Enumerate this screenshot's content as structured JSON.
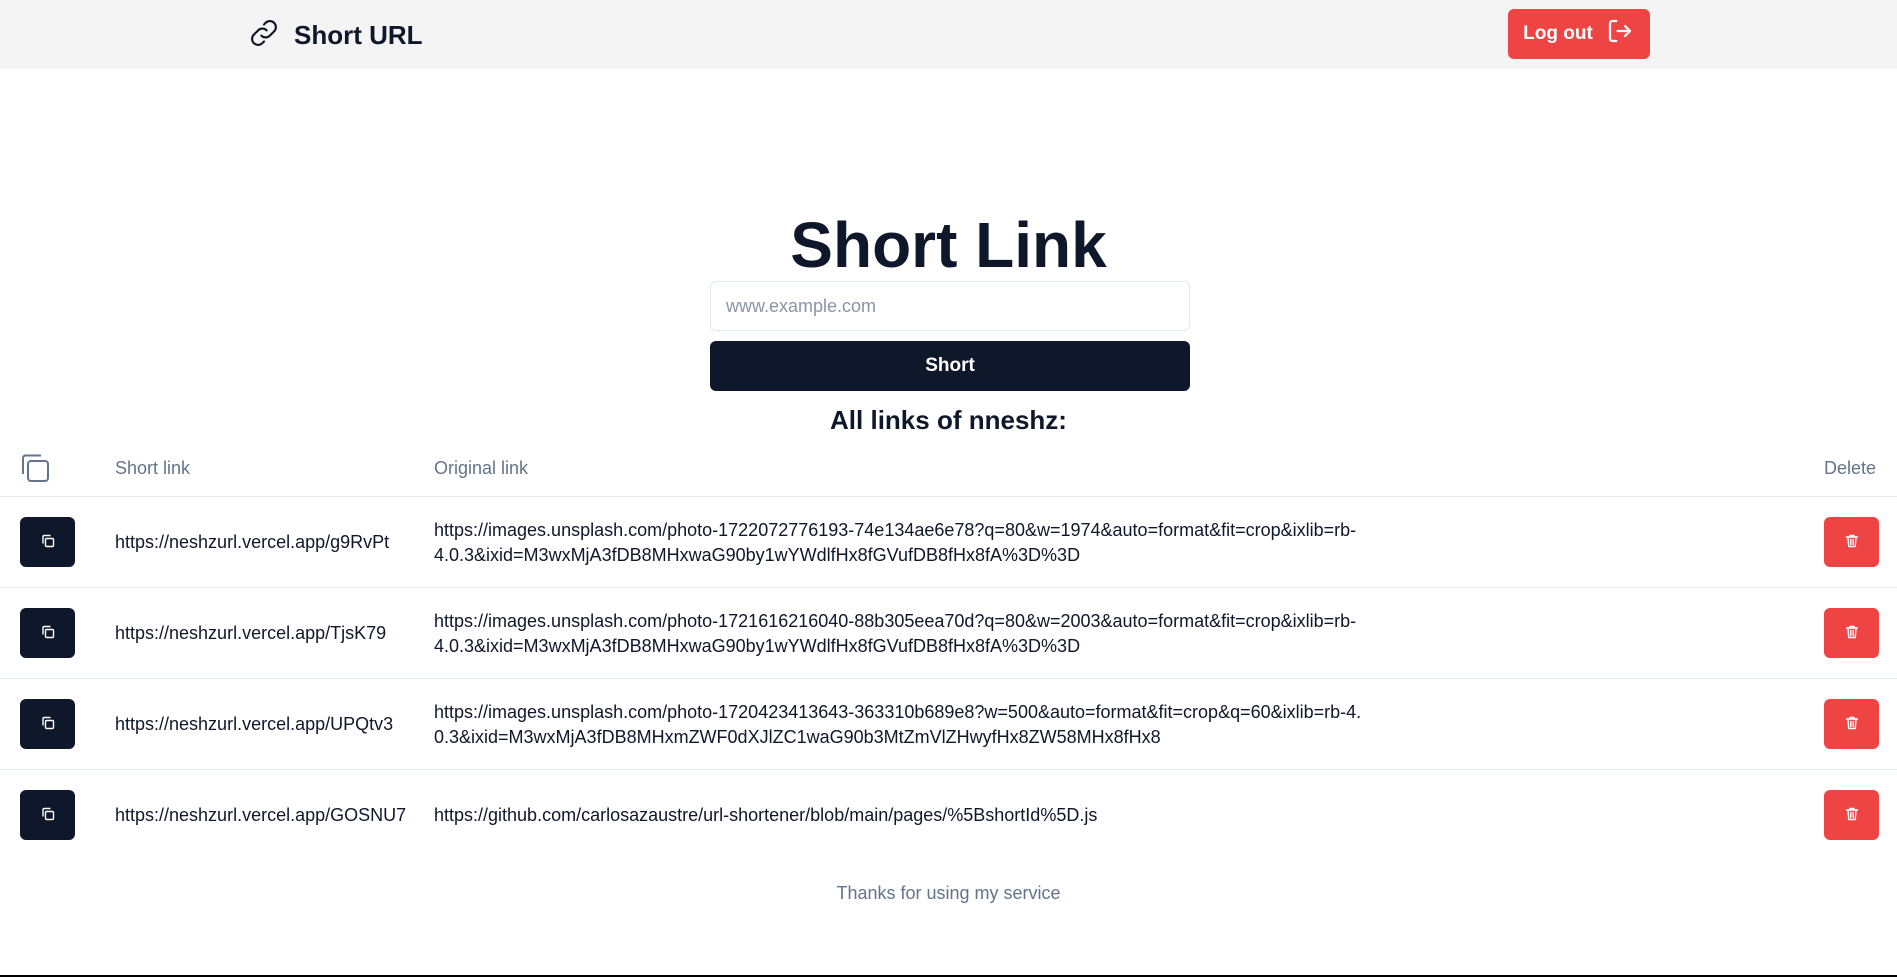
{
  "header": {
    "brand_title": "Short URL",
    "brand_icon": "link-icon",
    "logout_label": "Log out",
    "logout_icon": "logout-icon"
  },
  "main": {
    "title": "Short Link",
    "input_placeholder": "www.example.com",
    "input_value": "",
    "submit_label": "Short",
    "links_heading": "All links of nneshz:"
  },
  "table": {
    "headers": {
      "copy_icon": "copy-icon",
      "short_link": "Short link",
      "original_link": "Original link",
      "delete": "Delete"
    },
    "rows": [
      {
        "short_link": "https://neshzurl.vercel.app/g9RvPt",
        "original_link": "https://images.unsplash.com/photo-1722072776193-74e134ae6e78?q=80&w=1974&auto=format&fit=crop&ixlib=rb-4.0.3&ixid=M3wxMjA3fDB8MHxwaG90by1wYWdlfHx8fGVufDB8fHx8fA%3D%3D"
      },
      {
        "short_link": "https://neshzurl.vercel.app/TjsK79",
        "original_link": "https://images.unsplash.com/photo-1721616216040-88b305eea70d?q=80&w=2003&auto=format&fit=crop&ixlib=rb-4.0.3&ixid=M3wxMjA3fDB8MHxwaG90by1wYWdlfHx8fGVufDB8fHx8fA%3D%3D"
      },
      {
        "short_link": "https://neshzurl.vercel.app/UPQtv3",
        "original_link": "https://images.unsplash.com/photo-1720423413643-363310b689e8?w=500&auto=format&fit=crop&q=60&ixlib=rb-4.0.3&ixid=M3wxMjA3fDB8MHxmZWF0dXJlZC1waG90b3MtZmVlZHwyfHx8ZW58MHx8fHx8"
      },
      {
        "short_link": "https://neshzurl.vercel.app/GOSNU7",
        "original_link": "https://github.com/carlosazaustre/url-shortener/blob/main/pages/%5BshortId%5D.js"
      }
    ]
  },
  "footer": {
    "text": "Thanks for using my service"
  },
  "colors": {
    "primary_dark": "#0f172a",
    "danger": "#ef4444",
    "header_bg": "#f4f4f4",
    "muted_text": "#64748b"
  }
}
